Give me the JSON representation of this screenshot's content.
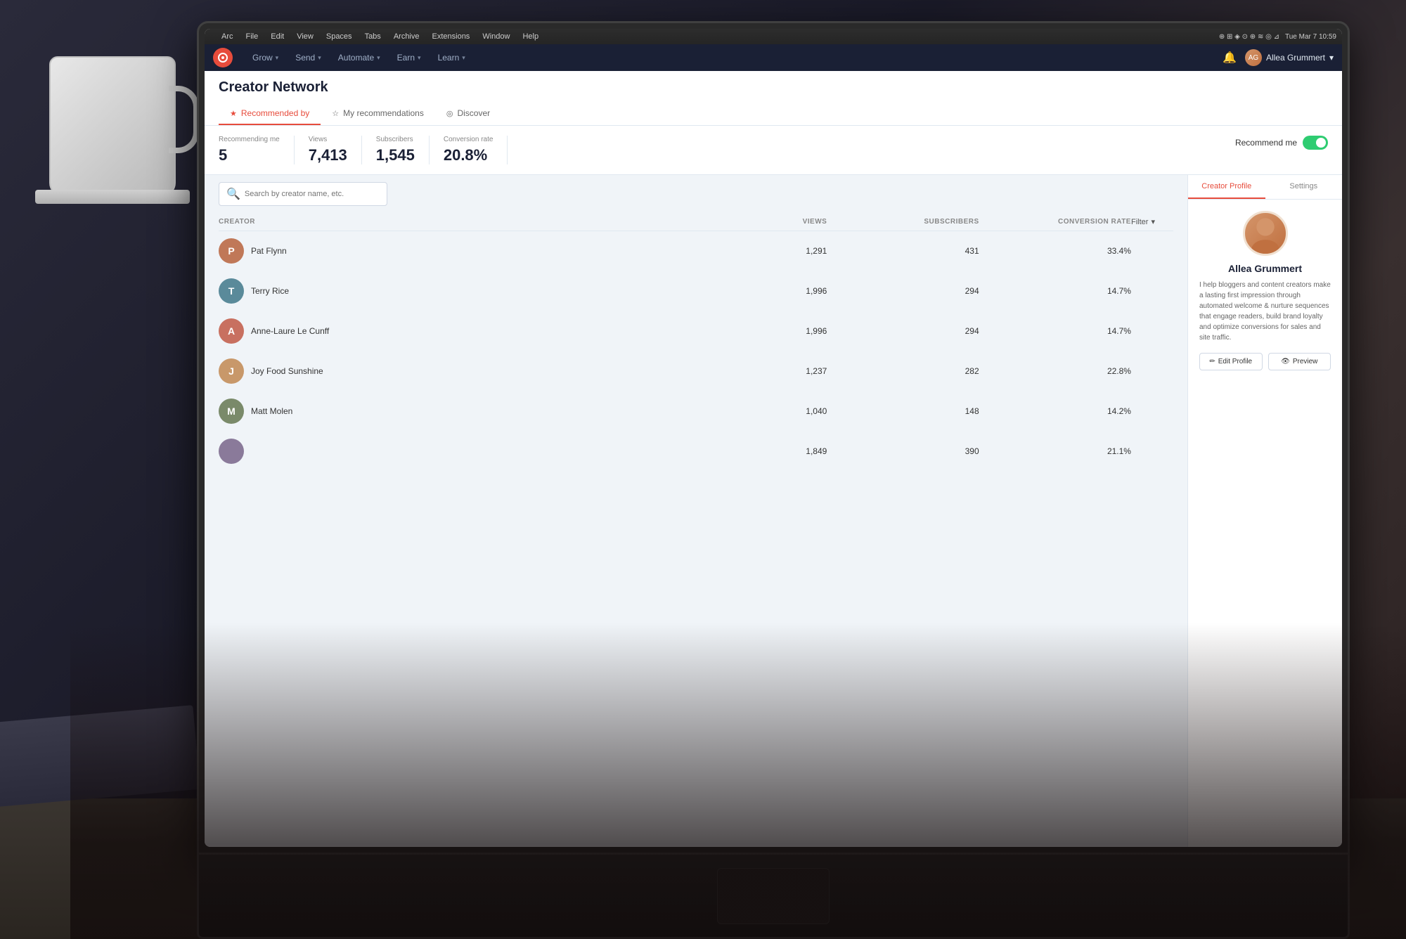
{
  "app": {
    "title": "Creator Network",
    "os_time": "Tue Mar 7  10:59"
  },
  "macos_menu": {
    "apple": "⌘",
    "items": [
      "Arc",
      "File",
      "Edit",
      "View",
      "Spaces",
      "Tabs",
      "Archive",
      "Extensions",
      "Window",
      "Help"
    ]
  },
  "navbar": {
    "logo_text": "○",
    "nav_items": [
      {
        "label": "Grow",
        "has_chevron": true
      },
      {
        "label": "Send",
        "has_chevron": true
      },
      {
        "label": "Automate",
        "has_chevron": true
      },
      {
        "label": "Earn",
        "has_chevron": true
      },
      {
        "label": "Learn",
        "has_chevron": true
      }
    ],
    "user_name": "Allea Grummert",
    "bell_icon": "🔔"
  },
  "tabs": [
    {
      "label": "Recommended by",
      "active": true,
      "icon": "★"
    },
    {
      "label": "My recommendations",
      "active": false,
      "icon": "☆"
    },
    {
      "label": "Discover",
      "active": false,
      "icon": "◎"
    }
  ],
  "stats": {
    "recommending_me": {
      "label": "Recommending me",
      "value": "5"
    },
    "views": {
      "label": "Views",
      "value": "7,413"
    },
    "subscribers": {
      "label": "Subscribers",
      "value": "1,545"
    },
    "conversion_rate": {
      "label": "Conversion rate",
      "value": "20.8%"
    },
    "recommend_toggle_label": "Recommend me"
  },
  "search": {
    "placeholder": "Search by creator name, etc."
  },
  "table": {
    "headers": {
      "creator": "Creator",
      "views": "Views",
      "subscribers": "Subscribers",
      "conversion_rate": "Conversion Rate",
      "filter": "Filter"
    },
    "rows": [
      {
        "name": "Pat Flynn",
        "views": "1,291",
        "subscribers": "431",
        "conversion_rate": "33.4%",
        "avatar_color": "#c07858",
        "avatar_initial": "P"
      },
      {
        "name": "Terry Rice",
        "views": "1,996",
        "subscribers": "294",
        "conversion_rate": "14.7%",
        "avatar_color": "#5a8a9a",
        "avatar_initial": "T"
      },
      {
        "name": "Anne-Laure Le Cunff",
        "views": "1,996",
        "subscribers": "294",
        "conversion_rate": "14.7%",
        "avatar_color": "#c87060",
        "avatar_initial": "A"
      },
      {
        "name": "Joy Food Sunshine",
        "views": "1,237",
        "subscribers": "282",
        "conversion_rate": "22.8%",
        "avatar_color": "#c8986a",
        "avatar_initial": "J"
      },
      {
        "name": "Matt Molen",
        "views": "1,040",
        "subscribers": "148",
        "conversion_rate": "14.2%",
        "avatar_color": "#7a8a6a",
        "avatar_initial": "M"
      },
      {
        "name": "",
        "views": "1,849",
        "subscribers": "390",
        "conversion_rate": "21.1%",
        "avatar_color": "#8a7a9a",
        "avatar_initial": "?"
      }
    ]
  },
  "profile": {
    "tabs": [
      "Creator Profile",
      "Settings"
    ],
    "active_tab": "Creator Profile",
    "name": "Allea Grummert",
    "bio": "I help bloggers and content creators make a lasting first impression through automated welcome & nurture sequences that engage readers, build brand loyalty and optimize conversions for sales and site traffic.",
    "edit_label": "Edit Profile",
    "preview_label": "Preview",
    "edit_icon": "✏",
    "preview_icon": "👁"
  }
}
